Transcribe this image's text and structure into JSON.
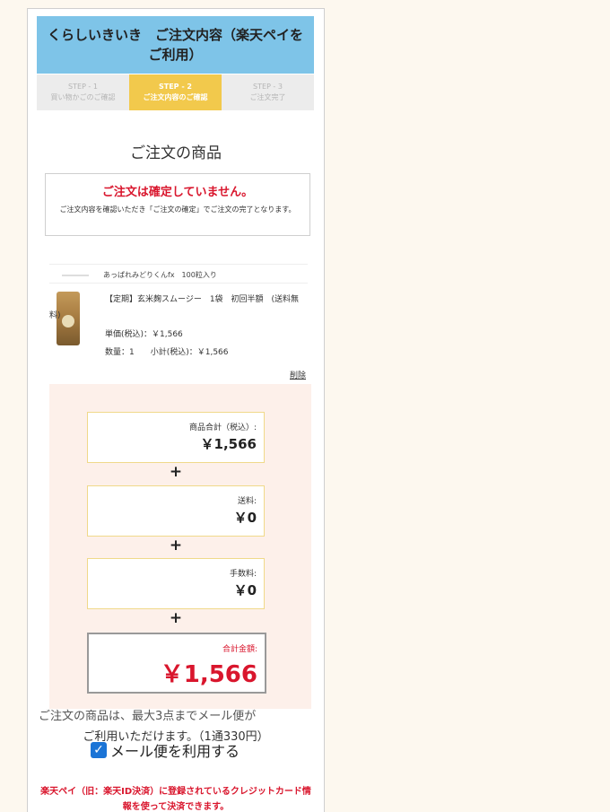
{
  "header": {
    "title": "くらしいきいき　ご注文内容（楽天ペイをご利用）"
  },
  "steps": [
    {
      "num": "STEP - 1",
      "label": "買い物かごのご確認"
    },
    {
      "num": "STEP - 2",
      "label": "ご注文内容のご確認"
    },
    {
      "num": "STEP - 3",
      "label": "ご注文完了"
    }
  ],
  "section": {
    "title": "ご注文の商品"
  },
  "notice": {
    "title": "ご注文は確定していません。",
    "text": "ご注文内容を確認いただき「ご注文の確定」でご注文の完了となります。"
  },
  "cutoff_item": {
    "text": "あっぱれみどりくんfx　100粒入り"
  },
  "item": {
    "name_line1": "【定期】玄米麹スムージー　1袋　初回半額　(送料無",
    "name_line2": "料)",
    "unit_price": "単価(税込)：￥1,566",
    "qty": "数量：1　　小計(税込)：￥1,566",
    "delete": "削除"
  },
  "summary": {
    "subtotal_label": "商品合計（税込）:",
    "subtotal": "￥1,566",
    "shipping_label": "送料:",
    "shipping": "￥0",
    "fee_label": "手数料:",
    "fee": "￥0",
    "total_label": "合計金額:",
    "total": "￥1,566",
    "plus": "+"
  },
  "mail": {
    "cut_text": "ご注文の商品は、最大3点までメール便が",
    "line": "ご利用いただけます。（1通330円）",
    "checkbox_label": "メール便を利用する",
    "checked": "✓"
  },
  "rakuten_note": "楽天ペイ（旧：楽天ID決済）に登録されているクレジットカード情報を使って決済できます。",
  "colors": {
    "header_bg": "#7ec4e8",
    "step_active": "#f2c94c",
    "accent_red": "#d9162d",
    "summary_bg": "#fdf0ea"
  }
}
